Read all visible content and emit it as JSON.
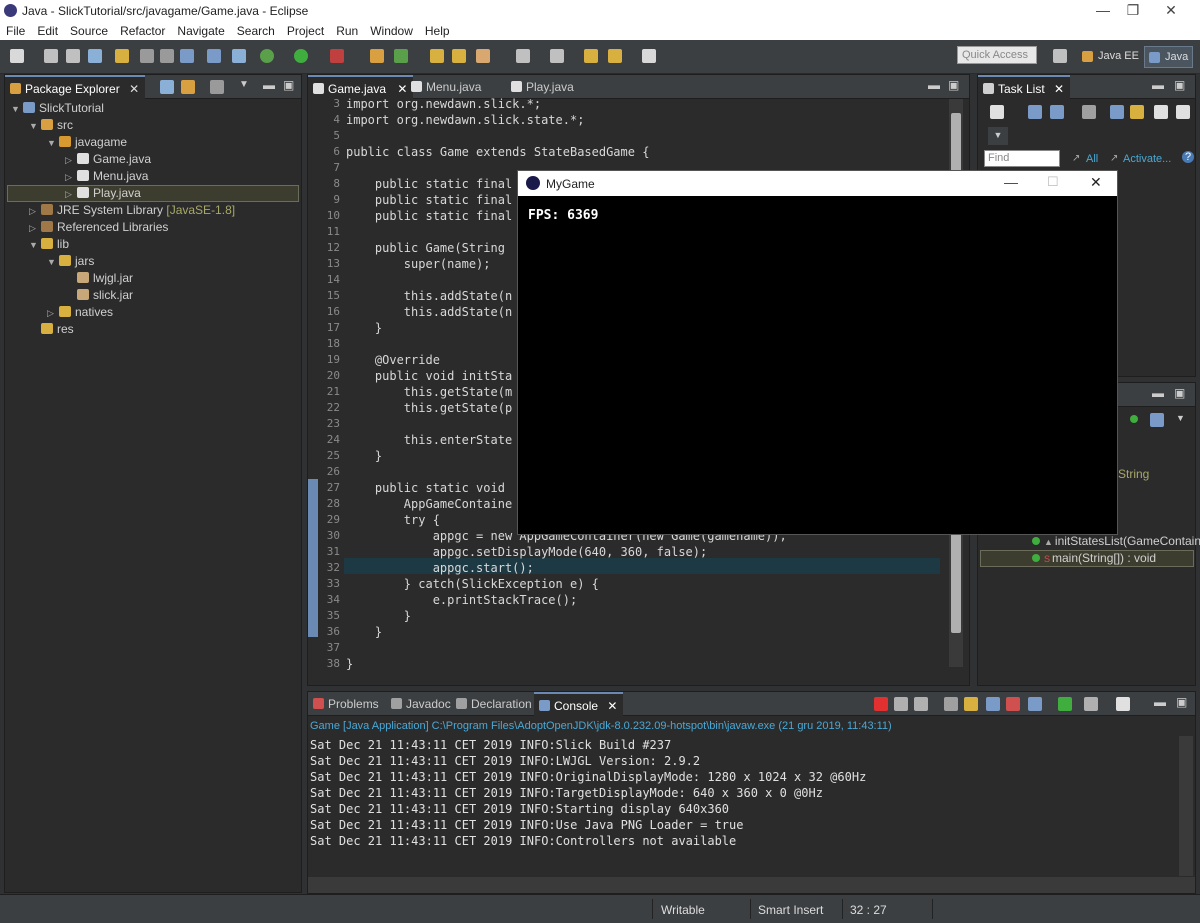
{
  "window": {
    "title": "Java - SlickTutorial/src/javagame/Game.java - Eclipse"
  },
  "menu": [
    "File",
    "Edit",
    "Source",
    "Refactor",
    "Navigate",
    "Search",
    "Project",
    "Run",
    "Window",
    "Help"
  ],
  "toolbar": {
    "quick_access": "Quick Access",
    "persp_javaee": "Java EE",
    "persp_java": "Java"
  },
  "package_explorer": {
    "tab": "Package Explorer",
    "rows": [
      {
        "label": "SlickTutorial",
        "extra": ""
      },
      {
        "label": "src",
        "extra": ""
      },
      {
        "label": "javagame",
        "extra": ""
      },
      {
        "label": "Game.java",
        "extra": ""
      },
      {
        "label": "Menu.java",
        "extra": ""
      },
      {
        "label": "Play.java",
        "extra": ""
      },
      {
        "label": "JRE System Library",
        "extra": "[JavaSE-1.8]"
      },
      {
        "label": "Referenced Libraries",
        "extra": ""
      },
      {
        "label": "lib",
        "extra": ""
      },
      {
        "label": "jars",
        "extra": ""
      },
      {
        "label": "lwjgl.jar",
        "extra": ""
      },
      {
        "label": "slick.jar",
        "extra": ""
      },
      {
        "label": "natives",
        "extra": ""
      },
      {
        "label": "res",
        "extra": ""
      }
    ]
  },
  "editor": {
    "tabs": [
      "Game.java",
      "Menu.java",
      "Play.java"
    ],
    "line_numbers": [
      "3",
      "4",
      "5",
      "6",
      "7",
      "8",
      "9",
      "10",
      "11",
      "12",
      "13",
      "14",
      "15",
      "16",
      "17",
      "18",
      "19",
      "20",
      "21",
      "22",
      "23",
      "24",
      "25",
      "26",
      "27",
      "28",
      "29",
      "30",
      "31",
      "32",
      "33",
      "34",
      "35",
      "36",
      "37",
      "38"
    ],
    "code": [
      "import org.newdawn.slick.*;",
      "import org.newdawn.slick.state.*;",
      "",
      "public class Game extends StateBasedGame {",
      "",
      "    public static final",
      "    public static final",
      "    public static final",
      "",
      "    public Game(String",
      "        super(name);",
      "",
      "        this.addState(n",
      "        this.addState(n",
      "    }",
      "",
      "    @Override",
      "    public void initSta",
      "        this.getState(m",
      "        this.getState(p",
      "",
      "        this.enterState",
      "    }",
      "",
      "    public static void",
      "        AppGameContaine",
      "        try {",
      "            appgc = new AppGameContainer(new Game(gamename));",
      "            appgc.setDisplayMode(640, 360, false);",
      "            appgc.start();",
      "        } catch(SlickException e) {",
      "            e.printStackTrace();",
      "        }",
      "    }",
      "",
      "}"
    ]
  },
  "tasks": {
    "tab": "Task List",
    "find_placeholder": "Find",
    "all": "All",
    "activate": "Activate..."
  },
  "outline": {
    "string_frag": "String",
    "items": [
      "initStatesList(GameContainer",
      "main(String[]) : void"
    ]
  },
  "console": {
    "tabs": [
      "Problems",
      "Javadoc",
      "Declaration",
      "Console"
    ],
    "header": "Game [Java Application] C:\\Program Files\\AdoptOpenJDK\\jdk-8.0.232.09-hotspot\\bin\\javaw.exe (21 gru 2019, 11:43:11)",
    "lines": [
      "Sat Dec 21 11:43:11 CET 2019 INFO:Slick Build #237",
      "Sat Dec 21 11:43:11 CET 2019 INFO:LWJGL Version: 2.9.2",
      "Sat Dec 21 11:43:11 CET 2019 INFO:OriginalDisplayMode: 1280 x 1024 x 32 @60Hz",
      "Sat Dec 21 11:43:11 CET 2019 INFO:TargetDisplayMode: 640 x 360 x 0 @0Hz",
      "Sat Dec 21 11:43:11 CET 2019 INFO:Starting display 640x360",
      "Sat Dec 21 11:43:11 CET 2019 INFO:Use Java PNG Loader = true",
      "Sat Dec 21 11:43:11 CET 2019 INFO:Controllers not available"
    ]
  },
  "status": {
    "writable": "Writable",
    "insert": "Smart Insert",
    "position": "32 : 27"
  },
  "game": {
    "title": "MyGame",
    "fps": "FPS: 6369"
  }
}
